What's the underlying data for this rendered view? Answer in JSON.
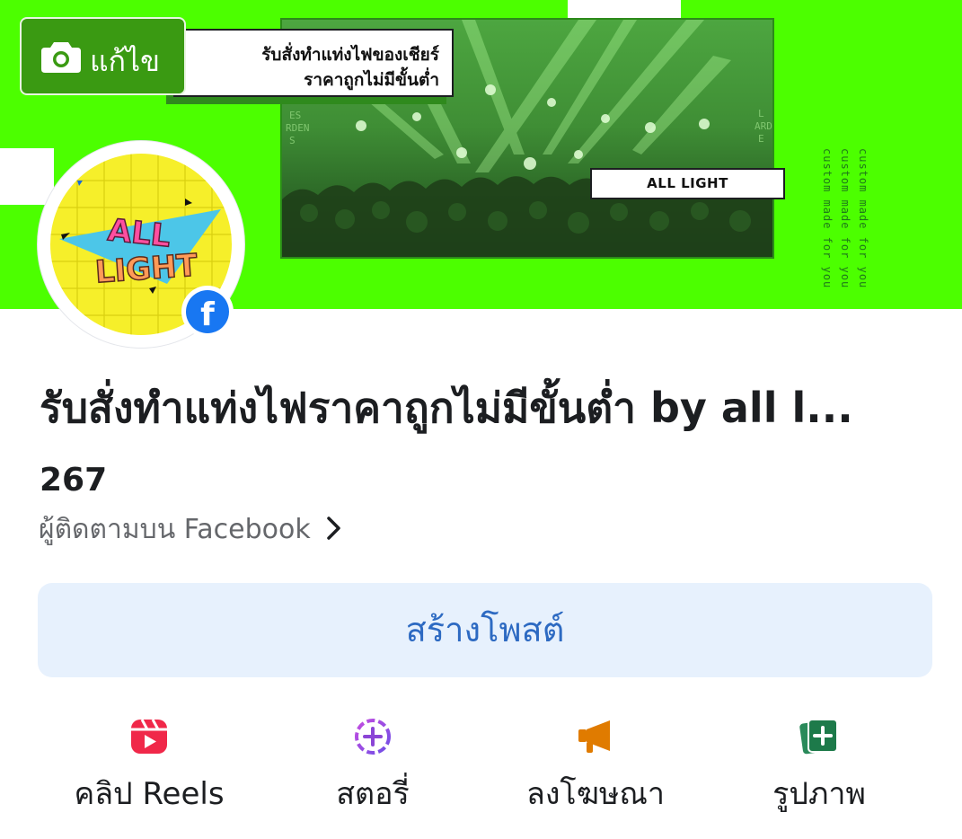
{
  "cover": {
    "title_line1": "รับสั่งทำแท่งไฟของเชียร์",
    "title_line2": "ราคาถูกไม่มีขั้นต่ำ",
    "tag": "ALL LIGHT",
    "vertical_text": "custom made for you",
    "edit_label": "แก้ไข",
    "bg_color": "#4cff00"
  },
  "avatar": {
    "logo_line1": "ALL",
    "logo_line2": "LIGHT",
    "badge": "f"
  },
  "page": {
    "name": "รับสั่งทำแท่งไฟราคาถูกไม่มีขั้นต่ำ by all l..."
  },
  "followers": {
    "count": "267",
    "label": "ผู้ติดตามบน Facebook"
  },
  "create_post": {
    "label": "สร้างโพสต์"
  },
  "actions": [
    {
      "label": "คลิป Reels",
      "icon": "reels-icon",
      "color": "#f02849"
    },
    {
      "label": "สตอรี่",
      "icon": "story-add-icon",
      "color": "#8b45d6"
    },
    {
      "label": "ลงโฆษณา",
      "icon": "megaphone-icon",
      "color": "#e07b00"
    },
    {
      "label": "รูปภาพ",
      "icon": "photo-add-icon",
      "color": "#1d7a4a"
    }
  ]
}
